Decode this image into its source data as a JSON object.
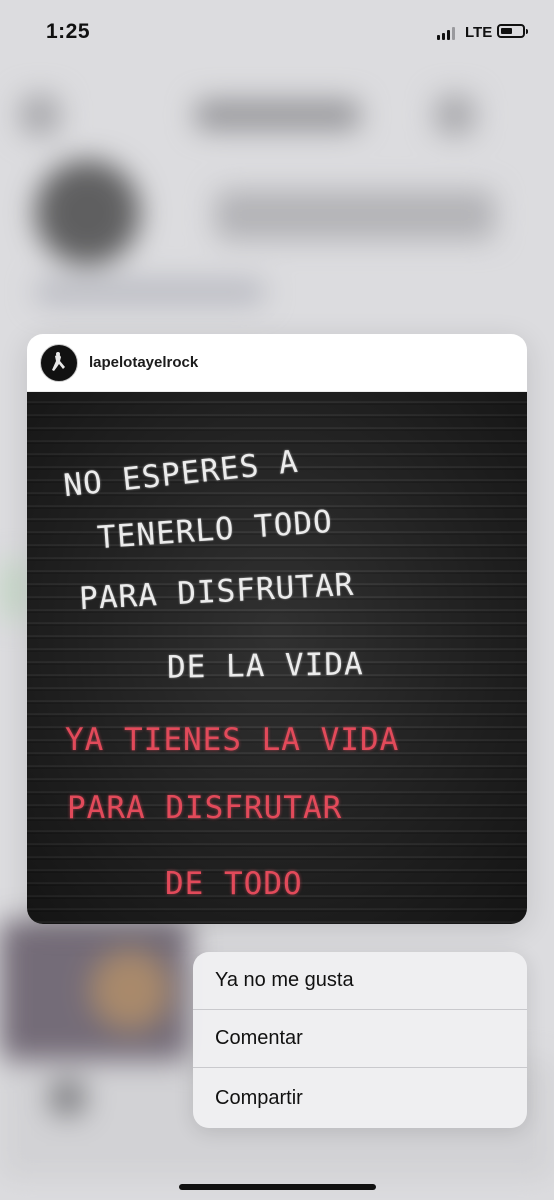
{
  "status_bar": {
    "time": "1:25",
    "network": "LTE",
    "signal_bars_active": 3,
    "battery_level": 0.4
  },
  "post": {
    "username": "lapelotayelrock",
    "avatar_icon": "bat-silhouette-icon",
    "board_lines_white": [
      "NO ESPERES A",
      "TENERLO TODO",
      "PARA DISFRUTAR",
      "DE LA VIDA"
    ],
    "board_lines_red": [
      "YA TIENES LA VIDA",
      "PARA DISFRUTAR",
      "DE TODO"
    ],
    "text_colors": {
      "white": "#ececec",
      "red": "#e24a5a"
    }
  },
  "context_menu": {
    "items": [
      {
        "label": "Ya no me gusta"
      },
      {
        "label": "Comentar"
      },
      {
        "label": "Compartir"
      }
    ]
  }
}
